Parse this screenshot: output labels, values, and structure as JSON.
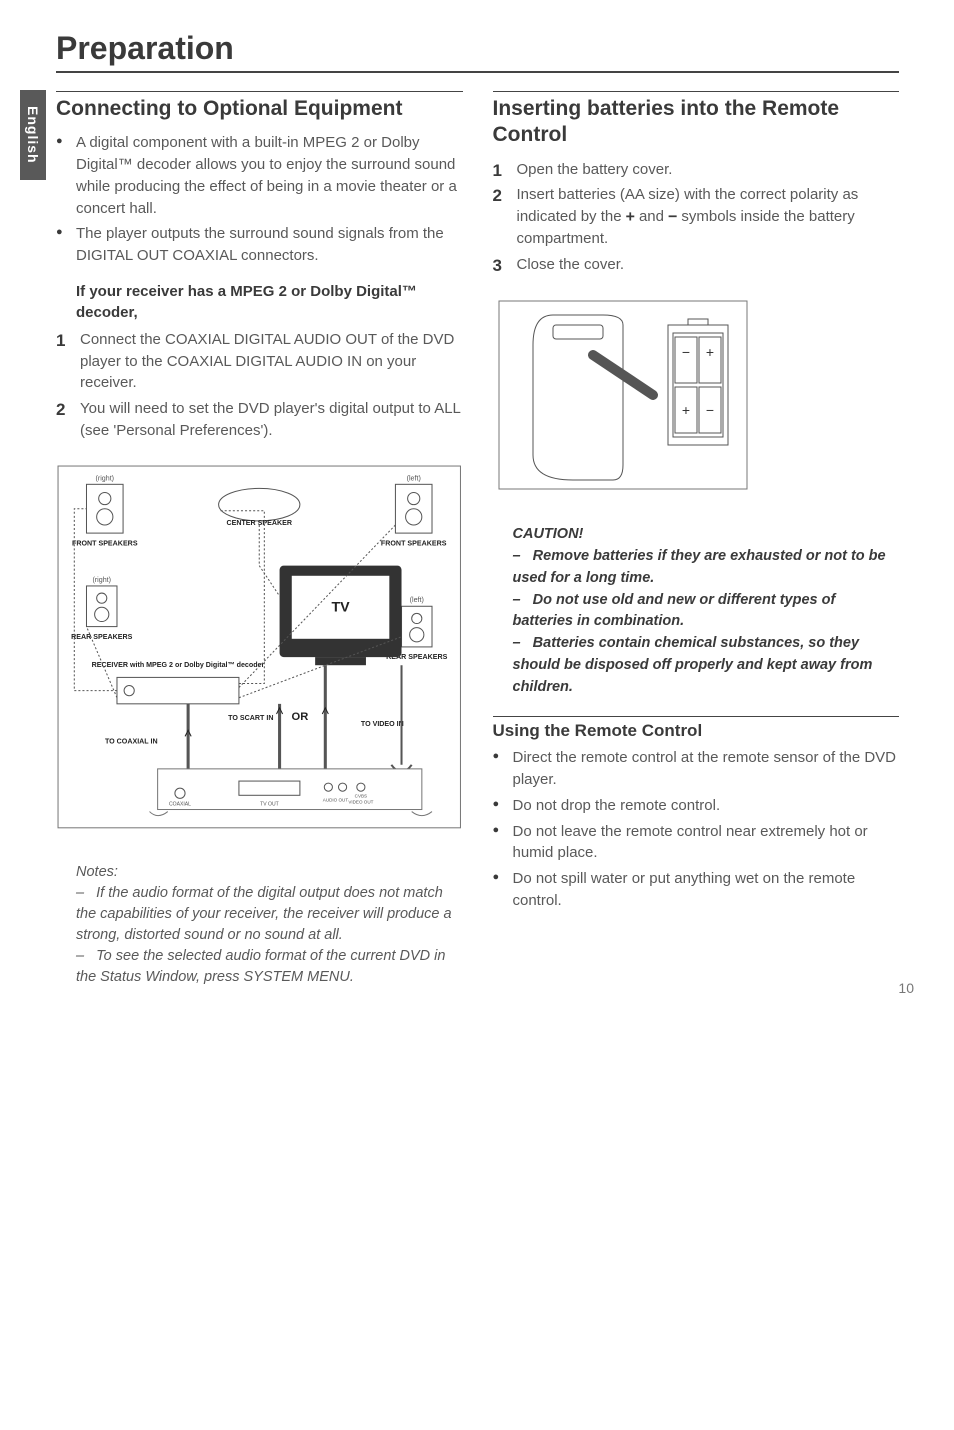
{
  "sideTab": "English",
  "title": "Preparation",
  "left": {
    "heading": "Connecting to Optional Equipment",
    "bullets": [
      "A digital component with a built-in MPEG 2 or Dolby Digital™ decoder allows you to enjoy the surround sound while producing the effect of being in a movie theater or a concert hall.",
      "The player outputs the surround sound signals from the DIGITAL OUT COAXIAL connectors."
    ],
    "subStrong": "If your receiver has a MPEG 2 or Dolby Digital™ decoder,",
    "steps": [
      "Connect the COAXIAL DIGITAL AUDIO OUT of the DVD player to the COAXIAL DIGITAL AUDIO IN on your receiver.",
      "You will need to set the DVD player's digital output to ALL (see 'Personal Preferences')."
    ],
    "diagram": {
      "frontSpeakers": "FRONT SPEAKERS",
      "rearSpeakers": "REAR SPEAKERS",
      "centerSpeaker": "CENTER SPEAKER",
      "right": "(right)",
      "left": "(left)",
      "tv": "TV",
      "receiver": "RECEIVER with MPEG 2 or Dolby Digital™ decoder",
      "toScart": "TO SCART IN",
      "or": "OR",
      "toVideo": "TO VIDEO IN",
      "toCoax": "TO COAXIAL IN",
      "coaxial": "COAXIAL",
      "tvout": "TV OUT",
      "audioOut": "AUDIO OUT",
      "cvbs": "CVBS",
      "videoOut": "VIDEO OUT"
    },
    "notesHeader": "Notes:",
    "notes": [
      "If the audio format of the digital output does not match the capabilities of your receiver, the receiver will produce a strong, distorted sound or no sound at all.",
      "To see the selected audio format of the current DVD in the Status Window, press SYSTEM MENU."
    ]
  },
  "right": {
    "heading1": "Inserting batteries into the Remote Control",
    "steps": [
      "Open the battery cover.",
      "Insert batteries (AA size) with the correct polarity as indicated by the + and − symbols inside the battery compartment.",
      "Close the cover."
    ],
    "cautionHeader": "CAUTION!",
    "cautions": [
      "Remove batteries if they are exhausted or not to be used for a long time.",
      "Do not use old and new or different types of batteries in combination.",
      "Batteries contain chemical substances, so they should be disposed off properly and kept away from children."
    ],
    "heading2": "Using the Remote Control",
    "bullets": [
      "Direct the remote control at the remote sensor of the DVD player.",
      "Do not drop the remote control.",
      "Do not leave the remote control near extremely hot or humid place.",
      "Do not spill water or put anything wet on the remote control."
    ]
  },
  "pageNumber": "10"
}
